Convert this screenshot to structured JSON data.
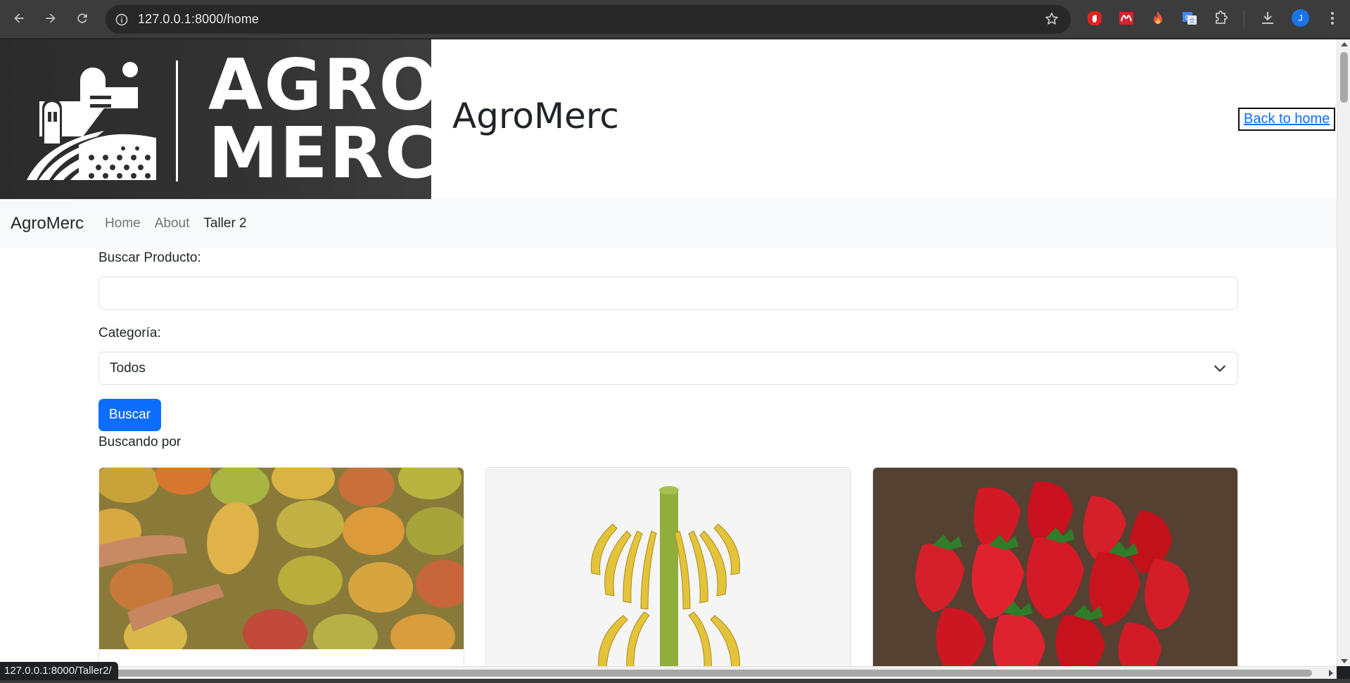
{
  "browser": {
    "url": "127.0.0.1:8000/home",
    "status_url": "127.0.0.1:8000/Taller2/",
    "profile_initial": "J"
  },
  "header": {
    "logo_text_line1": "AGRO",
    "logo_text_line2": "MERC",
    "site_title": "AgroMerc",
    "back_link": "Back to home"
  },
  "navbar": {
    "brand": "AgroMerc",
    "links": [
      "Home",
      "About",
      "Taller 2"
    ]
  },
  "search": {
    "product_label": "Buscar Producto:",
    "product_value": "",
    "category_label": "Categoría:",
    "category_selected": "Todos",
    "button_label": "Buscar",
    "searching_text": "Buscando por"
  },
  "colors": {
    "primary": "#0d6efd",
    "navbar_bg": "#f8f9fa",
    "logo_bg": "#2f2f2f"
  },
  "products": [
    {
      "image": "mango-photo"
    },
    {
      "image": "banana-bunch-photo"
    },
    {
      "image": "strawberry-photo"
    }
  ]
}
